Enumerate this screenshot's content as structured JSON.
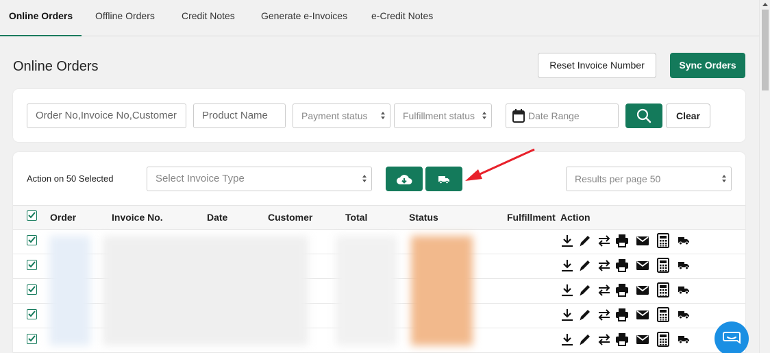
{
  "tabs": [
    {
      "label": "Online Orders",
      "active": true
    },
    {
      "label": "Offline Orders",
      "active": false
    },
    {
      "label": "Credit Notes",
      "active": false
    },
    {
      "label": "Generate e-Invoices",
      "active": false
    },
    {
      "label": "e-Credit Notes",
      "active": false
    }
  ],
  "page": {
    "title": "Online Orders"
  },
  "header_buttons": {
    "reset_invoice_number": "Reset Invoice Number",
    "sync_orders": "Sync Orders"
  },
  "filters": {
    "search_placeholder": "Order No,Invoice No,Customer",
    "product_placeholder": "Product Name",
    "payment_status": "Payment status",
    "fulfillment_status": "Fulfillment status",
    "date_range_placeholder": "Date Range",
    "clear_label": "Clear"
  },
  "bulk": {
    "action_label": "Action on 50 Selected",
    "invoice_type_placeholder": "Select Invoice Type",
    "results_per_page": "Results per page 50"
  },
  "table": {
    "columns": [
      "Order",
      "Invoice No.",
      "Date",
      "Customer",
      "Total",
      "Status",
      "Fulfillment",
      "Action"
    ],
    "all_selected": true,
    "rows_visible": 5,
    "row_actions": [
      "download-icon",
      "edit-icon",
      "transfer-icon",
      "print-icon",
      "mail-icon",
      "calculator-icon",
      "delivery-truck-icon"
    ]
  },
  "colors": {
    "brand_green": "#147a5b",
    "arrow_red": "#e8212b",
    "chat_blue": "#1a8fe3"
  }
}
